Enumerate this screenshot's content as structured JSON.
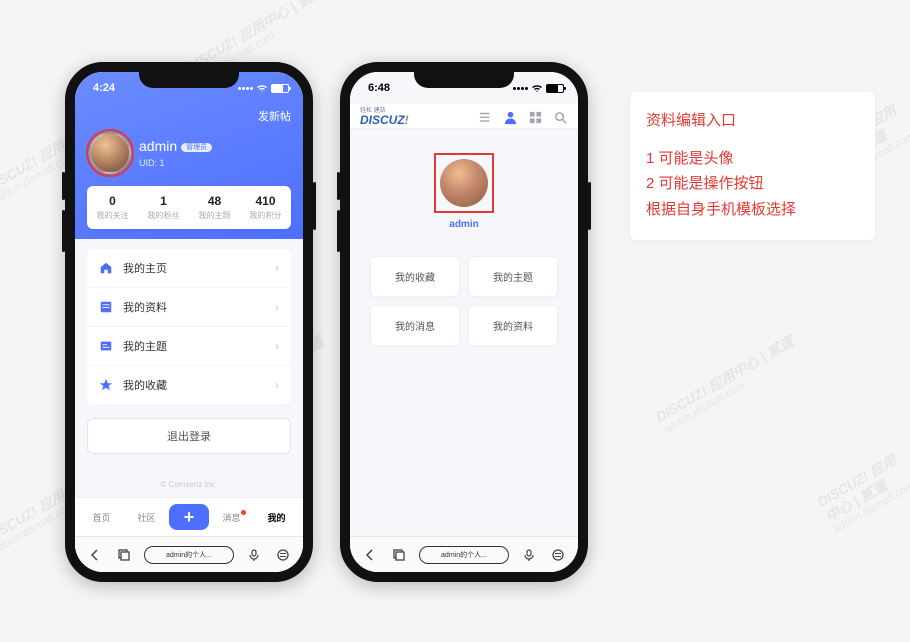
{
  "left_phone": {
    "status_time": "4:24",
    "header": {
      "action": "发新帖",
      "username": "admin",
      "tag": "管理员",
      "uid_line": "UID: 1"
    },
    "stats": [
      {
        "num": "0",
        "lbl": "我的关注"
      },
      {
        "num": "1",
        "lbl": "我的粉丝"
      },
      {
        "num": "48",
        "lbl": "我的主题"
      },
      {
        "num": "410",
        "lbl": "我的积分"
      }
    ],
    "menu": [
      "我的主页",
      "我的资料",
      "我的主题",
      "我的收藏"
    ],
    "logout": "退出登录",
    "copyright": "© Comsenz Inc.",
    "bottom_nav": {
      "items": [
        "首页",
        "社区",
        "消息",
        "我的"
      ]
    },
    "addr": "admin的个人..."
  },
  "right_phone": {
    "status_time": "6:48",
    "logo_sub": "轻松 建站",
    "logo_main": "DISCUZ",
    "username": "admin",
    "tiles": [
      "我的收藏",
      "我的主题",
      "我的消息",
      "我的资料"
    ],
    "addr": "admin的个人..."
  },
  "note": {
    "title": "资料编辑入口",
    "line1": "1 可能是头像",
    "line2": "2 可能是操作按钮",
    "line3": "根据自身手机模板选择"
  },
  "watermark": {
    "brand": "DISCUZ! 应用中心 | 贰道",
    "url": "addon.dismall.com"
  }
}
